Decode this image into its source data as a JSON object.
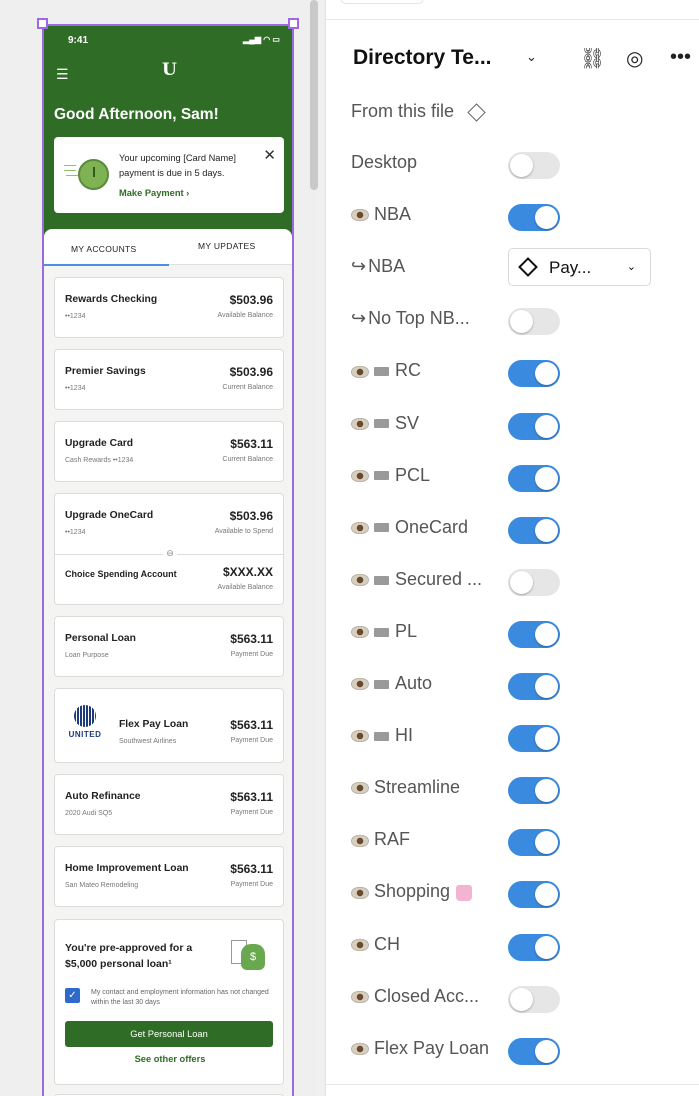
{
  "phone": {
    "time": "9:41",
    "signal": "▂▄▆ ◠ ▭",
    "logo": "U",
    "greeting": "Good Afternoon, Sam!",
    "notice": {
      "text": "Your upcoming [Card Name] payment is due in 5 days.",
      "link": "Make Payment ›"
    },
    "tabs": [
      "MY ACCOUNTS",
      "MY UPDATES"
    ],
    "accounts": [
      {
        "name": "Rewards Checking",
        "sub": "••1234",
        "amount": "$503.96",
        "label": "Available Balance"
      },
      {
        "name": "Premier Savings",
        "sub": "••1234",
        "amount": "$503.96",
        "label": "Current Balance"
      },
      {
        "name": "Upgrade Card",
        "sub": "Cash Rewards ••1234",
        "amount": "$563.11",
        "label": "Current Balance"
      },
      {
        "name": "Upgrade OneCard",
        "sub": "••1234",
        "amount": "$503.96",
        "label": "Available to Spend"
      },
      {
        "name": "Choice Spending Account",
        "sub": "",
        "amount": "$XXX.XX",
        "label": "Available Balance"
      },
      {
        "name": "Personal Loan",
        "sub": "Loan Purpose",
        "amount": "$563.11",
        "label": "Payment Due"
      },
      {
        "name": "Flex Pay Loan",
        "sub": "Southwest Airlines",
        "amount": "$563.11",
        "label": "Payment Due"
      },
      {
        "name": "Auto Refinance",
        "sub": "2020 Audi SQ5",
        "amount": "$563.11",
        "label": "Payment Due"
      },
      {
        "name": "Home Improvement Loan",
        "sub": "San Mateo Remodeling",
        "amount": "$563.11",
        "label": "Payment Due"
      }
    ],
    "united_word": "UNITED",
    "promo": {
      "title": "You're pre-approved for a $5,000 personal loan¹",
      "check_text": "My contact and employment information has not changed within the last 30 days",
      "button": "Get Personal Loan",
      "link": "See other offers"
    }
  },
  "panel": {
    "title": "Directory Te...",
    "icons": [
      "⛓",
      "◎",
      "•••"
    ],
    "from_file": "From this file",
    "rows": [
      {
        "label": "Desktop",
        "prefix": "",
        "on": false
      },
      {
        "label": "NBA",
        "prefix": "eye",
        "on": true
      },
      {
        "label": "NBA",
        "prefix": "arrow",
        "dropdown": "Pay..."
      },
      {
        "label": "No Top NB...",
        "prefix": "arrow",
        "on": false
      },
      {
        "label": "RC",
        "prefix": "eye-bar",
        "on": true
      },
      {
        "label": "SV",
        "prefix": "eye-bar",
        "on": true
      },
      {
        "label": "PCL",
        "prefix": "eye-bar",
        "on": true
      },
      {
        "label": "OneCard",
        "prefix": "eye-bar",
        "on": true
      },
      {
        "label": "Secured ...",
        "prefix": "eye-bar",
        "on": false
      },
      {
        "label": "PL",
        "prefix": "eye-bar",
        "on": true
      },
      {
        "label": "Auto",
        "prefix": "eye-bar",
        "on": true
      },
      {
        "label": "HI",
        "prefix": "eye-bar",
        "on": true
      },
      {
        "label": "Streamline",
        "prefix": "eye",
        "on": true
      },
      {
        "label": "RAF",
        "prefix": "eye",
        "on": true
      },
      {
        "label": "Shopping",
        "prefix": "eye",
        "on": true,
        "bag": true
      },
      {
        "label": "CH",
        "prefix": "eye",
        "on": true
      },
      {
        "label": "Closed Acc...",
        "prefix": "eye",
        "on": false
      },
      {
        "label": "Flex Pay Loan",
        "prefix": "eye",
        "on": true
      }
    ]
  },
  "colors": {
    "brand_green": "#2f6c26",
    "toggle_on": "#3a8be0",
    "selection": "#9b69e0"
  }
}
